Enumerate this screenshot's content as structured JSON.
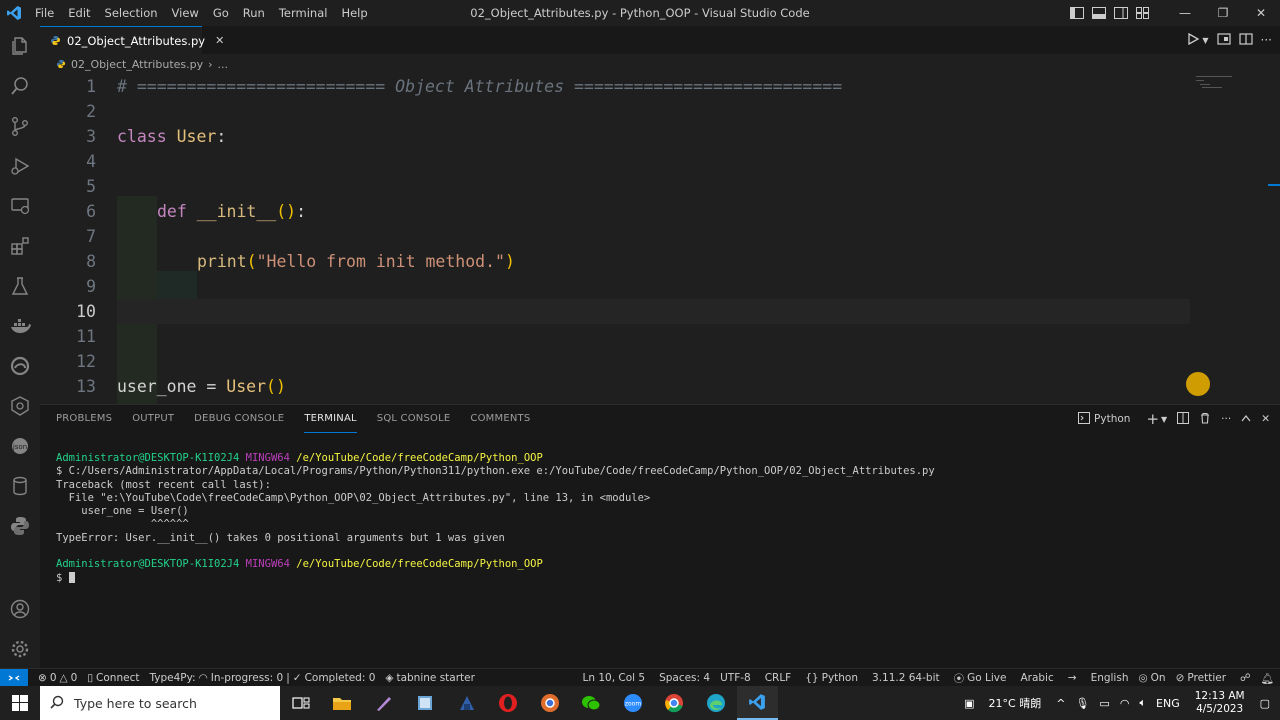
{
  "window": {
    "title": "02_Object_Attributes.py - Python_OOP - Visual Studio Code",
    "menu": [
      "File",
      "Edit",
      "Selection",
      "View",
      "Go",
      "Run",
      "Terminal",
      "Help"
    ]
  },
  "editor": {
    "tab": {
      "label": "02_Object_Attributes.py",
      "close": "✕"
    },
    "breadcrumb": {
      "file": "02_Object_Attributes.py",
      "sep": "›",
      "more": "..."
    },
    "lines": [
      {
        "n": "1",
        "text": "# ========================= Object Attributes ==========================="
      },
      {
        "n": "2",
        "text": ""
      },
      {
        "n": "3",
        "kw": "class",
        "name": "User",
        "rest": ":"
      },
      {
        "n": "4",
        "text": ""
      },
      {
        "n": "5",
        "text": ""
      },
      {
        "n": "6",
        "kw": "def",
        "name": "__init__",
        "open": "(",
        "close": ")",
        "rest": ":"
      },
      {
        "n": "7",
        "text": ""
      },
      {
        "n": "8",
        "fn": "print",
        "open": "(",
        "str": "\"Hello from init method.\"",
        "close": ")"
      },
      {
        "n": "9",
        "text": ""
      },
      {
        "n": "10",
        "text": ""
      },
      {
        "n": "11",
        "text": ""
      },
      {
        "n": "12",
        "text": ""
      },
      {
        "n": "13",
        "var": "user_one = ",
        "cls": "User",
        "paren": "()"
      }
    ],
    "active_line": "10"
  },
  "panel": {
    "tabs": [
      "PROBLEMS",
      "OUTPUT",
      "DEBUG CONSOLE",
      "TERMINAL",
      "SQL CONSOLE",
      "COMMENTS"
    ],
    "active_tab": "TERMINAL",
    "shell_label": "Python",
    "terminal": {
      "prompt_user": "Administrator@DESKTOP-K1I02J4",
      "prompt_sys": "MINGW64",
      "prompt_path": "/e/YouTube/Code/freeCodeCamp/Python_OOP",
      "command": "$ C:/Users/Administrator/AppData/Local/Programs/Python/Python311/python.exe e:/YouTube/Code/freeCodeCamp/Python_OOP/02_Object_Attributes.py",
      "traceback": "Traceback (most recent call last):",
      "file_line": "  File \"e:\\YouTube\\Code\\freeCodeCamp\\Python_OOP\\02_Object_Attributes.py\", line 13, in <module>",
      "code_line": "    user_one = User()",
      "caret_line": "               ^^^^^^",
      "error": "TypeError: User.__init__() takes 0 positional arguments but 1 was given",
      "prompt_symbol": "$"
    }
  },
  "status": {
    "errors": "0",
    "warnings": "0",
    "connect": "Connect",
    "type4py": "Type4Py:",
    "in_progress": "In-progress: 0",
    "completed": "Completed: 0",
    "tabnine": "tabnine starter",
    "position": "Ln 10, Col 5",
    "spaces": "Spaces: 4",
    "encoding": "UTF-8",
    "eol": "CRLF",
    "language": "Python",
    "interpreter": "3.11.2 64-bit",
    "golive": "Go Live",
    "arabic": "Arabic",
    "english": "English",
    "on": "On",
    "prettier": "Prettier"
  },
  "taskbar": {
    "search_placeholder": "Type here to search",
    "weather": "21°C 晴朗",
    "lang": "ENG",
    "time": "12:13 AM",
    "date": "4/5/2023"
  },
  "colors": {
    "accent": "#0078d4",
    "keyword": "#c586c0",
    "class": "#e5c07b",
    "string": "#ce9178",
    "terminal_green": "#23d18b",
    "terminal_yellow": "#f5f543"
  }
}
